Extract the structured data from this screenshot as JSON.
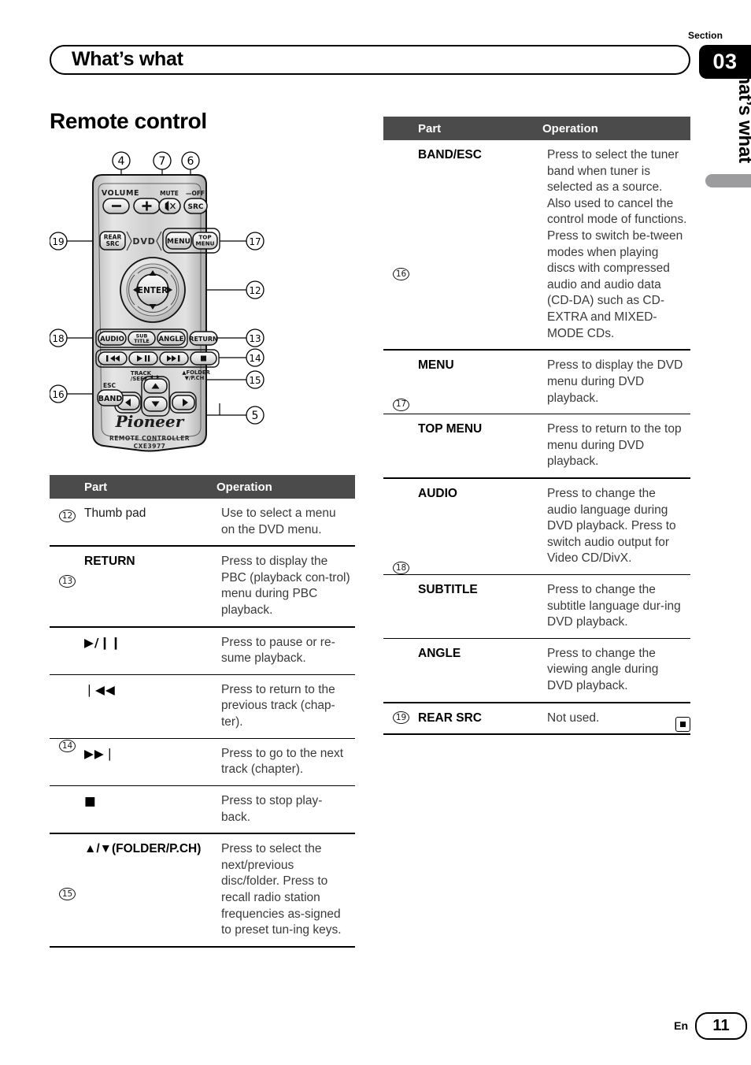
{
  "header": {
    "section_word": "Section",
    "section_number": "03",
    "chapter_title": "What’s what"
  },
  "side_tab": {
    "label": "What’s what"
  },
  "main": {
    "heading": "Remote control"
  },
  "figure": {
    "name": "pioneer-remote-control",
    "brand": "Pioneer",
    "caption_line1": "REMOTE CONTROLLER",
    "caption_line2": "CXE3977",
    "buttons": {
      "volume_label": "VOLUME",
      "volume_minus": "–",
      "volume_plus": "+",
      "mute_label": "MUTE",
      "src_off_label": "OFF",
      "src": "SRC",
      "rear_src_l1": "REAR",
      "rear_src_l2": "SRC",
      "dvd_label": "DVD",
      "menu": "MENU",
      "top_menu_l1": "TOP",
      "top_menu_l2": "MENU",
      "enter": "ENTER",
      "audio": "AUDIO",
      "subtitle_l1": "SUB",
      "subtitle_l2": "TITLE",
      "angle": "ANGLE",
      "return": "RETURN",
      "track_seek_l1": "TRACK",
      "track_seek_l2": "/SEEK",
      "folder_l1": "FOLDER",
      "folder_l2": "/P.CH",
      "esc_label": "ESC",
      "band": "BAND"
    },
    "callouts": [
      "4",
      "7",
      "6",
      "19",
      "17",
      "12",
      "18",
      "13",
      "14",
      "15",
      "16",
      "5"
    ]
  },
  "table_left": {
    "headers": {
      "num": "",
      "part": "Part",
      "operation": "Operation"
    },
    "groups": [
      {
        "num": "12",
        "rows": [
          {
            "part": "Thumb pad",
            "bold": false,
            "operation": "Use to select a menu on the DVD menu."
          }
        ]
      },
      {
        "num": "13",
        "rows": [
          {
            "part": "RETURN",
            "bold": true,
            "operation": "Press to display the PBC (playback con-trol) menu during PBC playback."
          }
        ]
      },
      {
        "num": "14",
        "rows": [
          {
            "part": "▶/❙❙",
            "bold": true,
            "operation": "Press to pause or re-sume playback."
          },
          {
            "part": "❘◀◀",
            "bold": true,
            "operation": "Press to return to the previous track (chap-ter)."
          },
          {
            "part": "▶▶❘",
            "bold": true,
            "operation": "Press to go to the next track (chapter)."
          },
          {
            "part": "■",
            "bold": true,
            "operation": "Press to stop play-back."
          }
        ]
      },
      {
        "num": "15",
        "rows": [
          {
            "part": "▲/▼(FOLDER/P.CH)",
            "bold": true,
            "operation": "Press to select the next/previous disc/folder. Press to recall radio station frequencies as-signed to preset tun-ing keys."
          }
        ]
      }
    ]
  },
  "table_right": {
    "headers": {
      "num": "",
      "part": "Part",
      "operation": "Operation"
    },
    "groups": [
      {
        "num": "16",
        "rows": [
          {
            "part": "BAND/ESC",
            "bold": true,
            "operation": "Press to select the tuner band when tuner is selected as a source. Also used to cancel the control mode of functions. Press to switch be-tween modes when playing discs with compressed audio and audio data (CD-DA) such as CD-EXTRA and MIXED-MODE CDs."
          }
        ]
      },
      {
        "num": "17",
        "rows": [
          {
            "part": "MENU",
            "bold": true,
            "operation": "Press to display the DVD menu during DVD playback."
          },
          {
            "part": "TOP MENU",
            "bold": true,
            "operation": "Press to return to the top menu during DVD playback."
          }
        ]
      },
      {
        "num": "18",
        "rows": [
          {
            "part": "AUDIO",
            "bold": true,
            "operation": "Press to change the audio language during DVD playback. Press to switch audio output for Video CD/DivX."
          },
          {
            "part": "SUBTITLE",
            "bold": true,
            "operation": "Press to change the subtitle language dur-ing DVD playback."
          },
          {
            "part": "ANGLE",
            "bold": true,
            "operation": "Press to change the viewing angle during DVD playback."
          }
        ]
      },
      {
        "num": "19",
        "rows": [
          {
            "part": "REAR SRC",
            "bold": true,
            "operation": "Not used."
          }
        ]
      }
    ]
  },
  "footer": {
    "language": "En",
    "page_number": "11"
  },
  "colors": {
    "table_header_bg": "#4b4b4b",
    "side_tab_bar": "#9c9c9f",
    "badge_bg": "#000000",
    "body_text": "#3a3a3a"
  }
}
